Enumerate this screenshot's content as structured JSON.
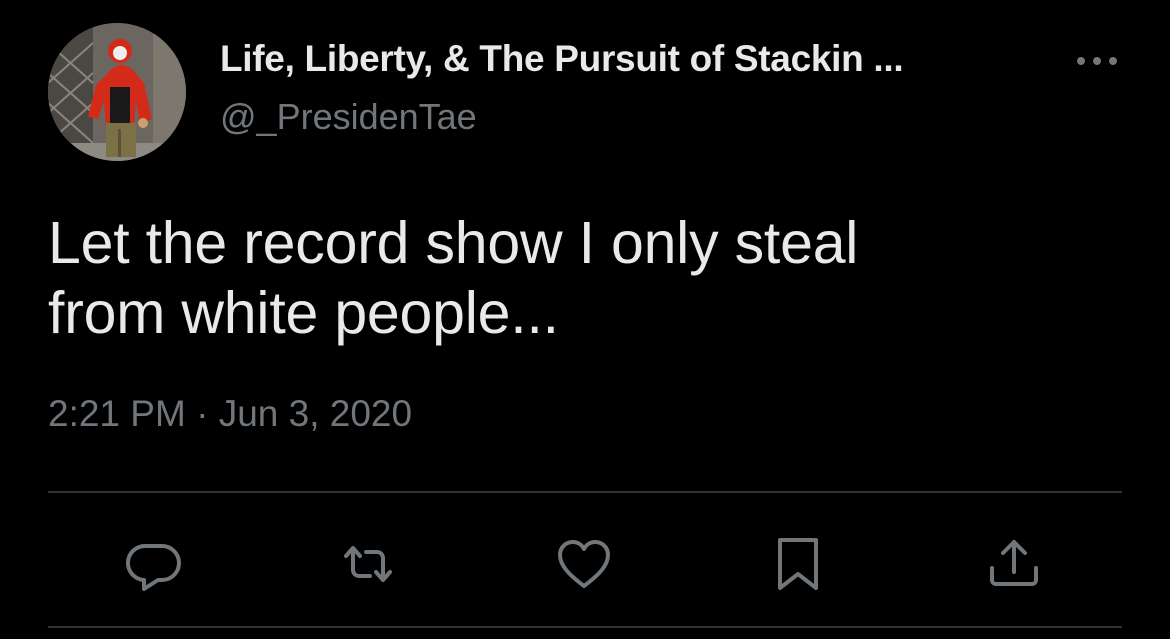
{
  "author": {
    "display_name": "Life, Liberty, & The Pursuit of Stackin ...",
    "handle": "@_PresidenTae"
  },
  "tweet": {
    "text_line_1": "Let the record show I only steal",
    "text_line_2": "from white people...",
    "time": "2:21 PM",
    "separator": "·",
    "date": "Jun 3, 2020"
  },
  "actions": [
    {
      "name": "reply",
      "icon": "reply-icon"
    },
    {
      "name": "retweet",
      "icon": "retweet-icon"
    },
    {
      "name": "like",
      "icon": "heart-icon"
    },
    {
      "name": "bookmark",
      "icon": "bookmark-icon"
    },
    {
      "name": "share",
      "icon": "share-icon"
    }
  ],
  "colors": {
    "background": "#000000",
    "primary_text": "#e7e9ea",
    "secondary_text": "#71767b",
    "divider": "#2f3336",
    "icon": "#71767b"
  }
}
